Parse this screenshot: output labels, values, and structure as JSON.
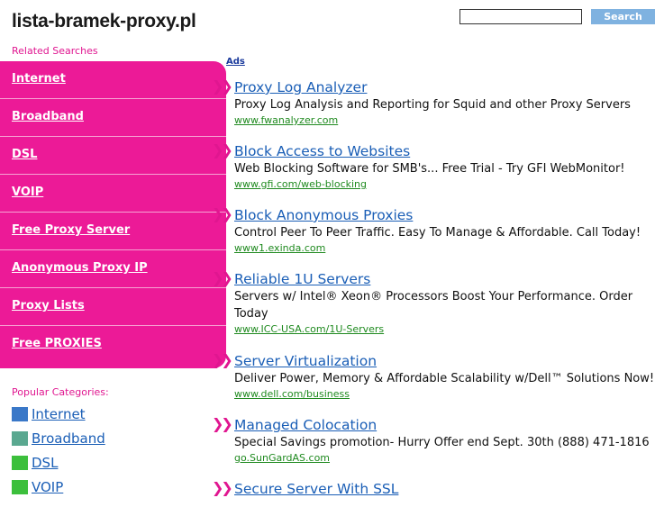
{
  "header": {
    "site_title": "lista-bramek-proxy.pl",
    "search_button": "Search"
  },
  "sidebar": {
    "related_label": "Related Searches",
    "items": [
      {
        "label": "Internet"
      },
      {
        "label": "Broadband"
      },
      {
        "label": "DSL"
      },
      {
        "label": "VOIP"
      },
      {
        "label": "Free Proxy Server"
      },
      {
        "label": "Anonymous Proxy IP"
      },
      {
        "label": "Proxy Lists"
      },
      {
        "label": "Free PROXIES"
      }
    ],
    "menu_color": "#ec1a97",
    "popular_label": "Popular Categories:",
    "categories": [
      {
        "label": "Internet",
        "color": "#3a78c8"
      },
      {
        "label": "Broadband",
        "color": "#5aa890"
      },
      {
        "label": "DSL",
        "color": "#3cbf3c"
      },
      {
        "label": "VOIP",
        "color": "#3cbf3c"
      }
    ]
  },
  "ads": {
    "label": "Ads",
    "items": [
      {
        "title": "Proxy Log Analyzer",
        "desc": "Proxy Log Analysis and Reporting for Squid and other Proxy Servers",
        "url": "www.fwanalyzer.com"
      },
      {
        "title": "Block Access to Websites",
        "desc": "Web Blocking Software for SMB's... Free Trial - Try GFI WebMonitor!",
        "url": "www.gfi.com/web-blocking"
      },
      {
        "title": "Block Anonymous Proxies",
        "desc": "Control Peer To Peer Traffic. Easy To Manage & Affordable. Call Today!",
        "url": "www1.exinda.com"
      },
      {
        "title": "Reliable 1U Servers",
        "desc": "Servers w/ Intel® Xeon® Processors Boost Your Performance. Order Today",
        "url": "www.ICC-USA.com/1U-Servers"
      },
      {
        "title": "Server Virtualization",
        "desc": "Deliver Power, Memory & Affordable Scalability w/Dell™ Solutions Now!",
        "url": "www.dell.com/business"
      },
      {
        "title": "Managed Colocation",
        "desc": "Special Savings promotion- Hurry Offer end Sept. 30th (888) 471-1816",
        "url": "go.SunGardAS.com"
      },
      {
        "title": "Secure Server With SSL",
        "desc": "",
        "url": ""
      }
    ]
  }
}
